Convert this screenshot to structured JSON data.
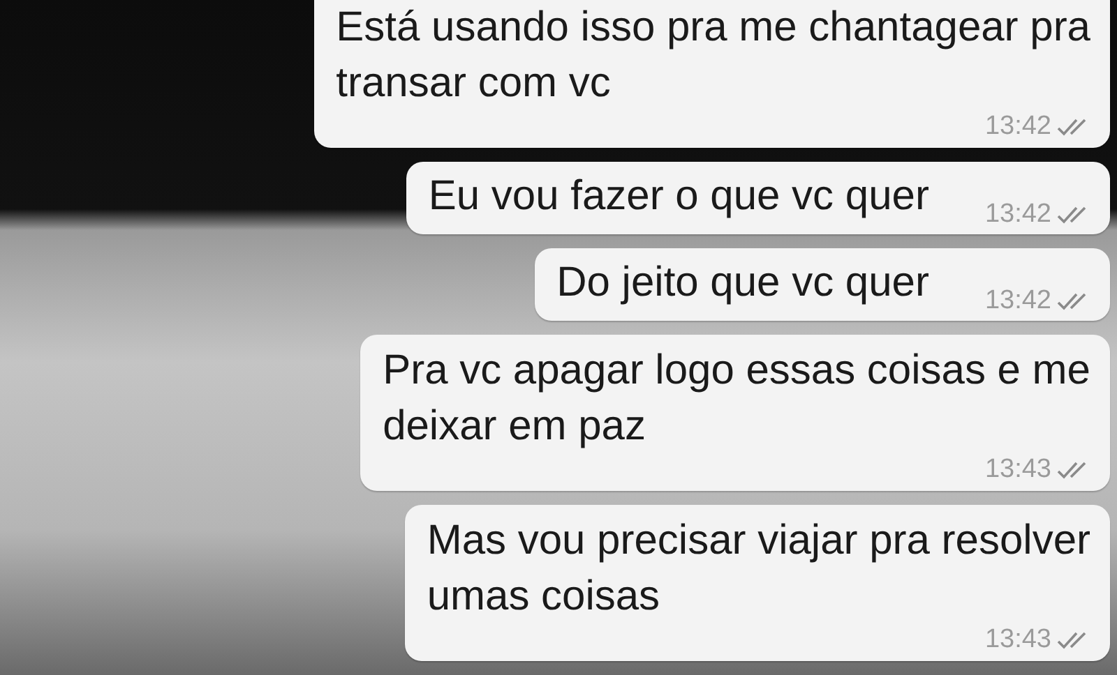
{
  "messages": [
    {
      "text": "Está usando isso pra me chantagear pra\ntransar com vc",
      "time": "13:42",
      "read": false
    },
    {
      "text": "Eu vou fazer o que vc quer",
      "time": "13:42",
      "read": false
    },
    {
      "text": "Do jeito que vc quer",
      "time": "13:42",
      "read": false
    },
    {
      "text": "Pra vc apagar logo essas coisas e me\ndeixar em paz",
      "time": "13:43",
      "read": false
    },
    {
      "text": "Mas vou precisar viajar pra resolver\numas coisas",
      "time": "13:43",
      "read": false
    }
  ]
}
